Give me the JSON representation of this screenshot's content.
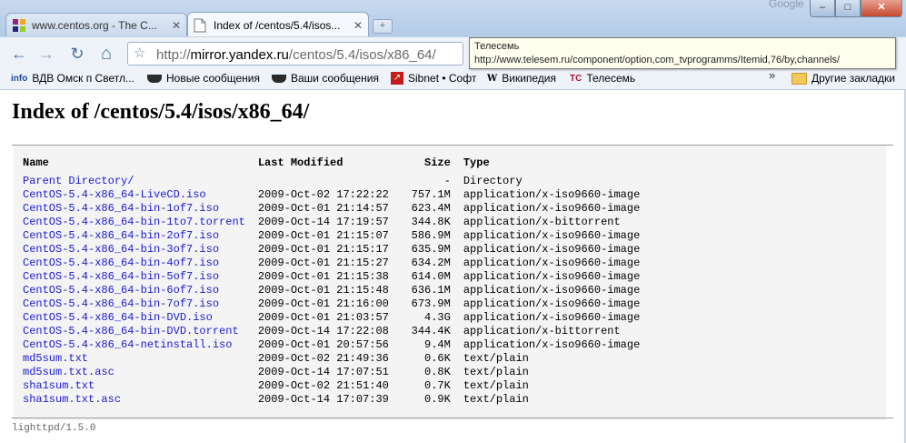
{
  "window": {
    "google_label": "Google",
    "min_label": "–",
    "max_label": "□",
    "close_label": "✕"
  },
  "tabs": [
    {
      "title": "www.centos.org - The C...",
      "active": false
    },
    {
      "title": "Index of /centos/5.4/isos...",
      "active": true
    }
  ],
  "toolbar": {
    "back_icon": "←",
    "forward_icon": "→",
    "reload_icon": "↻",
    "home_icon": "⌂",
    "url_scheme": "http://",
    "url_host": "mirror.yandex.ru",
    "url_path": "/centos/5.4/isos/x86_64/"
  },
  "tooltip": {
    "title": "Телесемь",
    "url": "http://www.telesem.ru/component/option,com_tvprogramms/Itemid,76/by,channels/"
  },
  "bookmarks": {
    "items": [
      {
        "icon": "info",
        "label": "ВДВ Омск п Светл..."
      },
      {
        "icon": "ship-icon",
        "label": "Новые сообщения"
      },
      {
        "icon": "ship-icon",
        "label": "Ваши сообщения"
      },
      {
        "icon": "sibnet-icon",
        "label": "Sibnet • Софт"
      },
      {
        "icon": "W",
        "label": "Википедия"
      },
      {
        "icon": "TC",
        "label": "Телесемь"
      }
    ],
    "overflow": "»",
    "other_label": "Другие закладки"
  },
  "page": {
    "heading": "Index of /centos/5.4/isos/x86_64/",
    "columns": {
      "name": "Name",
      "modified": "Last Modified",
      "size": "Size",
      "type": "Type"
    },
    "rows": [
      {
        "name": "Parent Directory/",
        "modified": "",
        "size": "-",
        "type": "Directory"
      },
      {
        "name": "CentOS-5.4-x86_64-LiveCD.iso",
        "modified": "2009-Oct-02 17:22:22",
        "size": "757.1M",
        "type": "application/x-iso9660-image"
      },
      {
        "name": "CentOS-5.4-x86_64-bin-1of7.iso",
        "modified": "2009-Oct-01 21:14:57",
        "size": "623.4M",
        "type": "application/x-iso9660-image"
      },
      {
        "name": "CentOS-5.4-x86_64-bin-1to7.torrent",
        "modified": "2009-Oct-14 17:19:57",
        "size": "344.8K",
        "type": "application/x-bittorrent"
      },
      {
        "name": "CentOS-5.4-x86_64-bin-2of7.iso",
        "modified": "2009-Oct-01 21:15:07",
        "size": "586.9M",
        "type": "application/x-iso9660-image"
      },
      {
        "name": "CentOS-5.4-x86_64-bin-3of7.iso",
        "modified": "2009-Oct-01 21:15:17",
        "size": "635.9M",
        "type": "application/x-iso9660-image"
      },
      {
        "name": "CentOS-5.4-x86_64-bin-4of7.iso",
        "modified": "2009-Oct-01 21:15:27",
        "size": "634.2M",
        "type": "application/x-iso9660-image"
      },
      {
        "name": "CentOS-5.4-x86_64-bin-5of7.iso",
        "modified": "2009-Oct-01 21:15:38",
        "size": "614.0M",
        "type": "application/x-iso9660-image"
      },
      {
        "name": "CentOS-5.4-x86_64-bin-6of7.iso",
        "modified": "2009-Oct-01 21:15:48",
        "size": "636.1M",
        "type": "application/x-iso9660-image"
      },
      {
        "name": "CentOS-5.4-x86_64-bin-7of7.iso",
        "modified": "2009-Oct-01 21:16:00",
        "size": "673.9M",
        "type": "application/x-iso9660-image"
      },
      {
        "name": "CentOS-5.4-x86_64-bin-DVD.iso",
        "modified": "2009-Oct-01 21:03:57",
        "size": "4.3G",
        "type": "application/x-iso9660-image"
      },
      {
        "name": "CentOS-5.4-x86_64-bin-DVD.torrent",
        "modified": "2009-Oct-14 17:22:08",
        "size": "344.4K",
        "type": "application/x-bittorrent"
      },
      {
        "name": "CentOS-5.4-x86_64-netinstall.iso",
        "modified": "2009-Oct-01 20:57:56",
        "size": "9.4M",
        "type": "application/x-iso9660-image"
      },
      {
        "name": "md5sum.txt",
        "modified": "2009-Oct-02 21:49:36",
        "size": "0.6K",
        "type": "text/plain"
      },
      {
        "name": "md5sum.txt.asc",
        "modified": "2009-Oct-14 17:07:51",
        "size": "0.8K",
        "type": "text/plain"
      },
      {
        "name": "sha1sum.txt",
        "modified": "2009-Oct-02 21:51:40",
        "size": "0.7K",
        "type": "text/plain"
      },
      {
        "name": "sha1sum.txt.asc",
        "modified": "2009-Oct-14 17:07:39",
        "size": "0.9K",
        "type": "text/plain"
      }
    ],
    "footer": "lighttpd/1.5.0"
  }
}
